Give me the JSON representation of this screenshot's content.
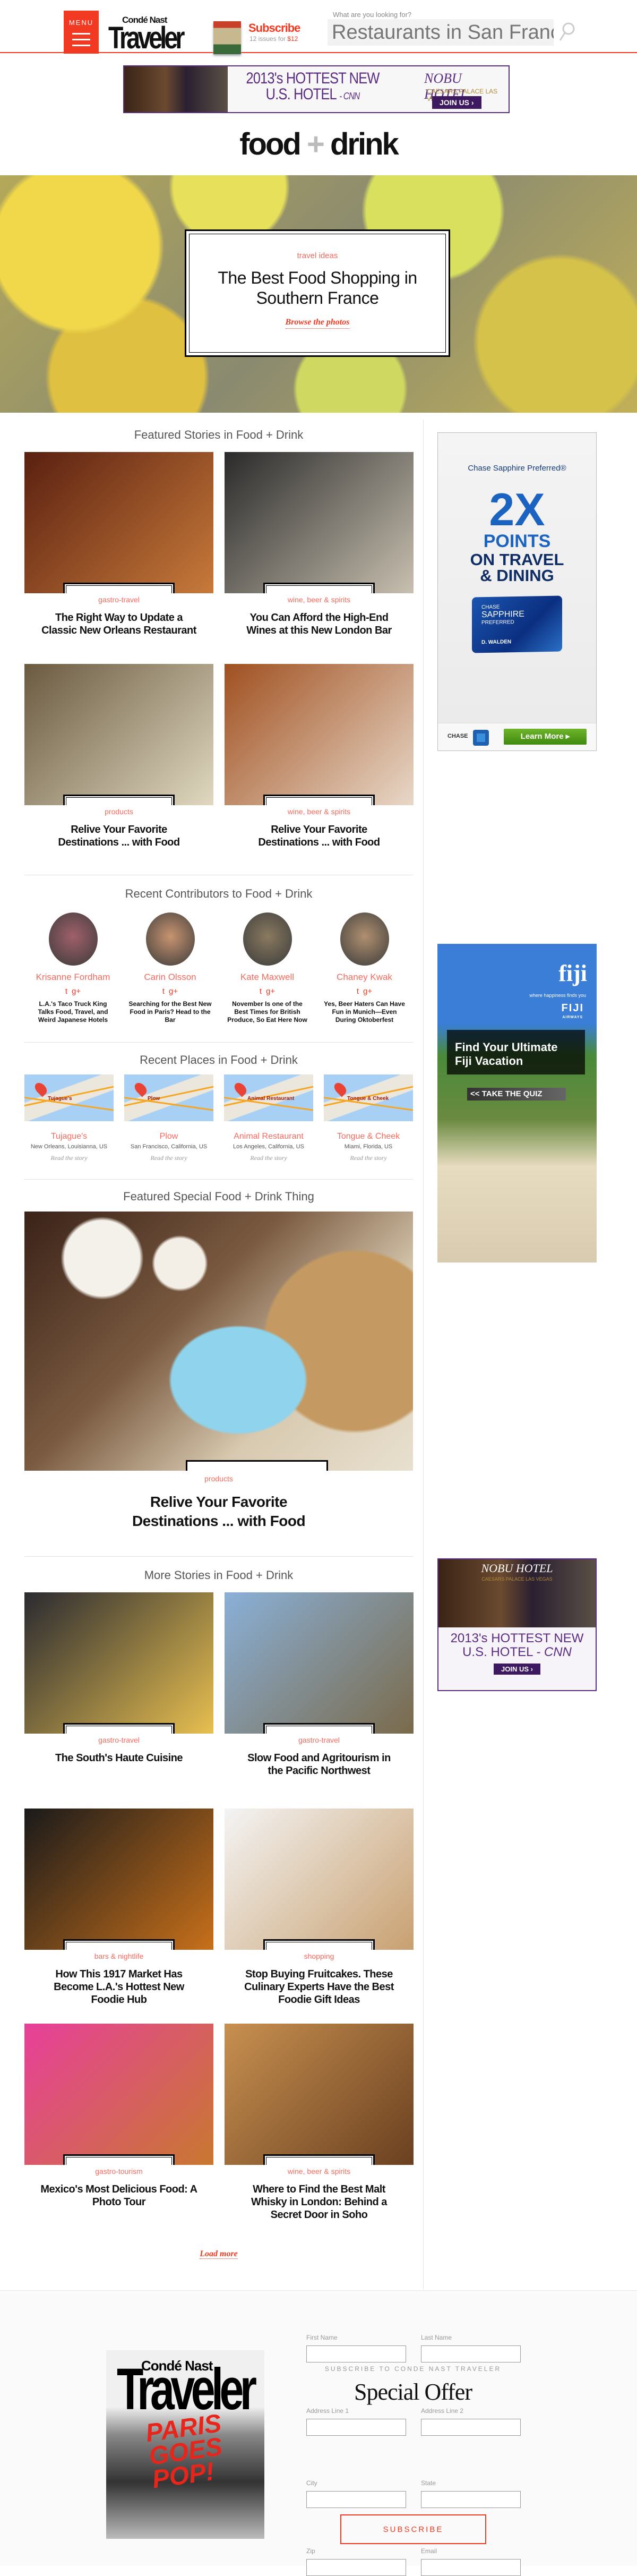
{
  "header": {
    "menu_label": "MENU",
    "logo_small": "Condé Nast",
    "logo_big": "Traveler",
    "subscribe_title": "Subscribe",
    "subscribe_sub_prefix": "12 issues for",
    "subscribe_price": "$12",
    "search_label": "What are you looking for?",
    "search_placeholder": "Restaurants in San Francisco"
  },
  "ads": {
    "nobu": {
      "headline1": "2013's HOTTEST NEW",
      "headline2": "U.S. HOTEL",
      "source": "- CNN",
      "brand": "NOBU HOTEL",
      "sub": "CAESARS PALACE LAS VEGAS",
      "cta": "JOIN US ›"
    },
    "chase": {
      "brand": "Chase Sapphire Preferred®",
      "big": "2X",
      "points": "POINTS",
      "line1": "ON TRAVEL",
      "line2": "& DINING",
      "card_brand": "CHASE",
      "card_name": "SAPPHIRE",
      "card_tier": "PREFERRED",
      "card_holder": "D. WALDEN",
      "logo": "CHASE",
      "cta": "Learn More ▸"
    },
    "fiji": {
      "logo": "fiji",
      "tagline": "where happiness finds you",
      "airline": "FIJI",
      "airline_sub": "AIRWAYS",
      "headline": "Find Your Ultimate Fiji Vacation",
      "cta": "<< TAKE THE QUIZ"
    }
  },
  "section": {
    "word1": "food",
    "plus": "+",
    "word2": "drink"
  },
  "hero": {
    "category": "travel ideas",
    "title": "The Best Food Shopping in Southern France",
    "link": "Browse the photos"
  },
  "featured": {
    "heading": "Featured Stories in Food + Drink",
    "items": [
      {
        "category": "gastro-travel",
        "title": "The Right Way to Update a Classic New Orleans Restaurant",
        "c1": "#5a2010",
        "c2": "#c87a3a"
      },
      {
        "category": "wine, beer & spirits",
        "title": "You Can Afford the High-End Wines at this New London Bar",
        "c1": "#2a2a2a",
        "c2": "#c8c0b0"
      },
      {
        "category": "products",
        "title": "Relive Your Favorite Destinations ... with Food",
        "c1": "#6a5a40",
        "c2": "#e0d8c0"
      },
      {
        "category": "wine, beer & spirits",
        "title": "Relive Your Favorite Destinations ... with Food",
        "c1": "#a05020",
        "c2": "#e8d8c8"
      }
    ]
  },
  "contributors": {
    "heading": "Recent Contributors to Food + Drink",
    "items": [
      {
        "name": "Krisanne Fordham",
        "story": "L.A.'s Taco Truck King Talks Food, Travel, and Weird Japanese Hotels",
        "color": "#a0606a"
      },
      {
        "name": "Carin Olsson",
        "story": "Searching for the Best New Food in Paris? Head to the Bar",
        "color": "#c89470"
      },
      {
        "name": "Kate Maxwell",
        "story": "November Is one of the Best Times for British Produce, So Eat Here Now",
        "color": "#8a7a60"
      },
      {
        "name": "Chaney Kwak",
        "story": "Yes, Beer Haters Can Have Fun in Munich—Even During Oktoberfest",
        "color": "#b09070"
      }
    ],
    "twitter_icon": "t",
    "gplus_icon": "g+"
  },
  "places": {
    "heading": "Recent Places in Food + Drink",
    "read_label": "Read the story",
    "items": [
      {
        "name": "Tujague's",
        "address": "New Orleans, Louisianna, US",
        "map_label": "Tujague's"
      },
      {
        "name": "Plow",
        "address": "San Francisco, California, US",
        "map_label": "Plow"
      },
      {
        "name": "Animal Restaurant",
        "address": "Los Angeles, California, US",
        "map_label": "Animal Restaurant"
      },
      {
        "name": "Tongue & Cheek",
        "address": "Miami, Florida, US",
        "map_label": "Tongue & Cheek"
      }
    ]
  },
  "special": {
    "heading": "Featured Special Food + Drink Thing",
    "category": "products",
    "title": "Relive Your Favorite Destinations ... with Food"
  },
  "more": {
    "heading": "More Stories in Food + Drink",
    "items": [
      {
        "category": "gastro-travel",
        "title": "The South's Haute Cuisine",
        "c1": "#2a2a30",
        "c2": "#e8c050"
      },
      {
        "category": "gastro-travel",
        "title": "Slow Food and Agritourism in the Pacific Northwest",
        "c1": "#8ab0d8",
        "c2": "#7a6a4a"
      },
      {
        "category": "bars & nightlife",
        "title": "How This 1917 Market Has Become L.A.'s Hottest New Foodie Hub",
        "c1": "#1a1a1a",
        "c2": "#c8701a"
      },
      {
        "category": "shopping",
        "title": "Stop Buying Fruitcakes. These Culinary Experts Have the Best Foodie Gift Ideas",
        "c1": "#f4f4f4",
        "c2": "#c8a070"
      },
      {
        "category": "gastro-tourism",
        "title": "Mexico's Most Delicious Food: A Photo Tour",
        "c1": "#e8409a",
        "c2": "#c87830"
      },
      {
        "category": "wine, beer & spirits",
        "title": "Where to Find the Best Malt Whisky in London: Behind a Secret Door in Soho",
        "c1": "#c89050",
        "c2": "#6a4020"
      }
    ],
    "load_more": "Load more"
  },
  "footer": {
    "cover_small": "Condé Nast",
    "cover_big": "Traveler",
    "cover_headline": "PARIS GOES POP!",
    "kicker": "SUBSCRIBE TO CONDE NAST TRAVELER",
    "title": "Special Offer",
    "fields": [
      "First Name",
      "Last Name",
      "Address Line 1",
      "Address Line 2",
      "City",
      "State",
      "Zip",
      "Email"
    ],
    "submit": "SUBSCRIBE"
  },
  "colors": {
    "accent": "#f23a22",
    "category": "#f46a5e",
    "ad_purple": "#5a2d82"
  }
}
